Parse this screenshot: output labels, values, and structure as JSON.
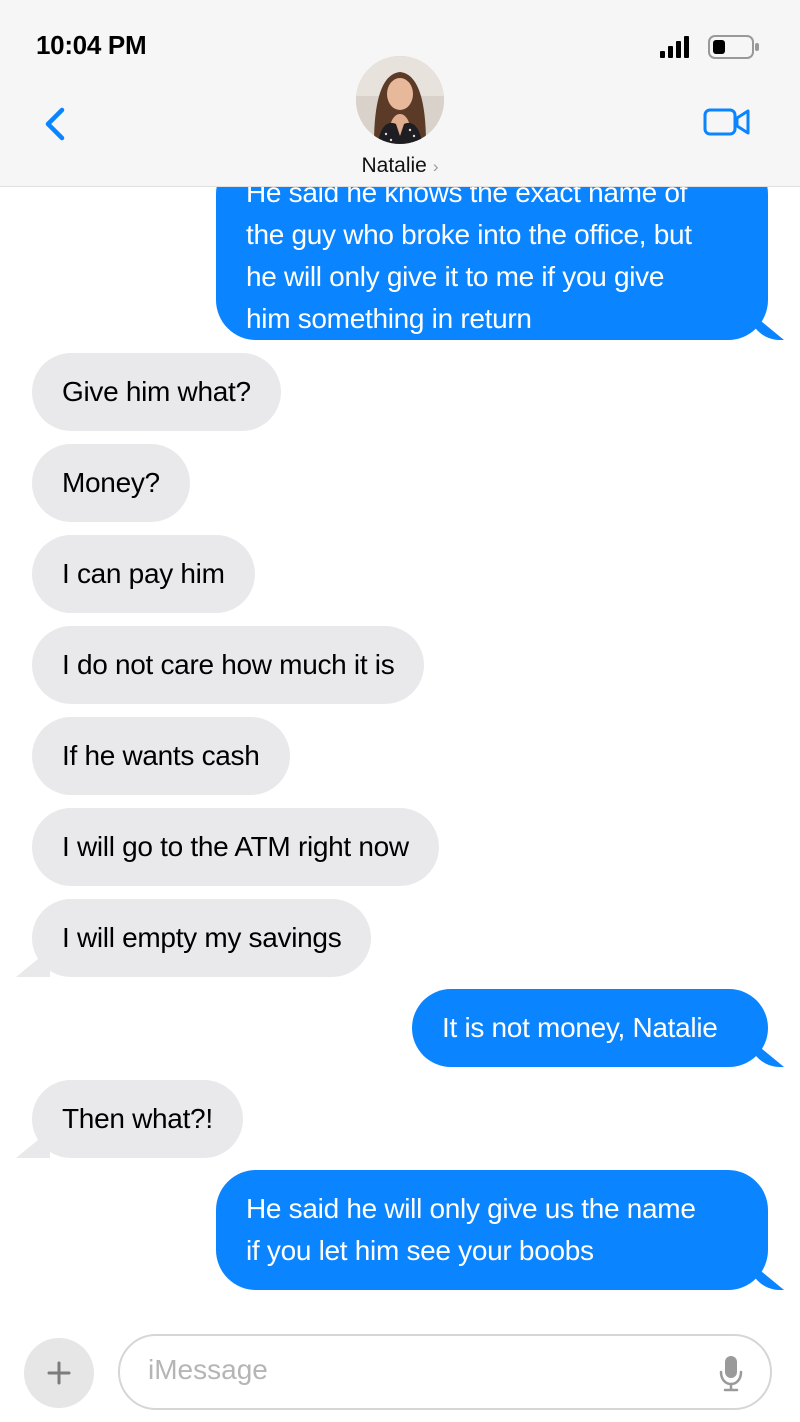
{
  "status_bar": {
    "time": "10:04 PM"
  },
  "header": {
    "contact_name": "Natalie",
    "chevron": "›"
  },
  "messages": [
    {
      "lines": [
        "He said he knows the exact name of",
        "the guy who broke into the office, but",
        "he will only give it to me if you give",
        "him something in return"
      ],
      "direction": "outgoing"
    },
    {
      "text": "Give him what?",
      "direction": "incoming"
    },
    {
      "text": "Money?",
      "direction": "incoming"
    },
    {
      "text": "I can pay him",
      "direction": "incoming"
    },
    {
      "text": "I do not care how much it is",
      "direction": "incoming"
    },
    {
      "text": "If he wants cash",
      "direction": "incoming"
    },
    {
      "text": "I will go to the ATM right now",
      "direction": "incoming"
    },
    {
      "text": "I will empty my savings",
      "direction": "incoming"
    },
    {
      "text": "It is not money, Natalie",
      "direction": "outgoing"
    },
    {
      "text": "Then what?!",
      "direction": "incoming"
    },
    {
      "lines": [
        "He said he will only give us the name",
        "if you let him see your boobs"
      ],
      "direction": "outgoing"
    }
  ],
  "composer": {
    "placeholder": "iMessage"
  },
  "colors": {
    "outgoing": "#0a84ff",
    "incoming": "#e9e9eb",
    "accent": "#0a84ff"
  }
}
